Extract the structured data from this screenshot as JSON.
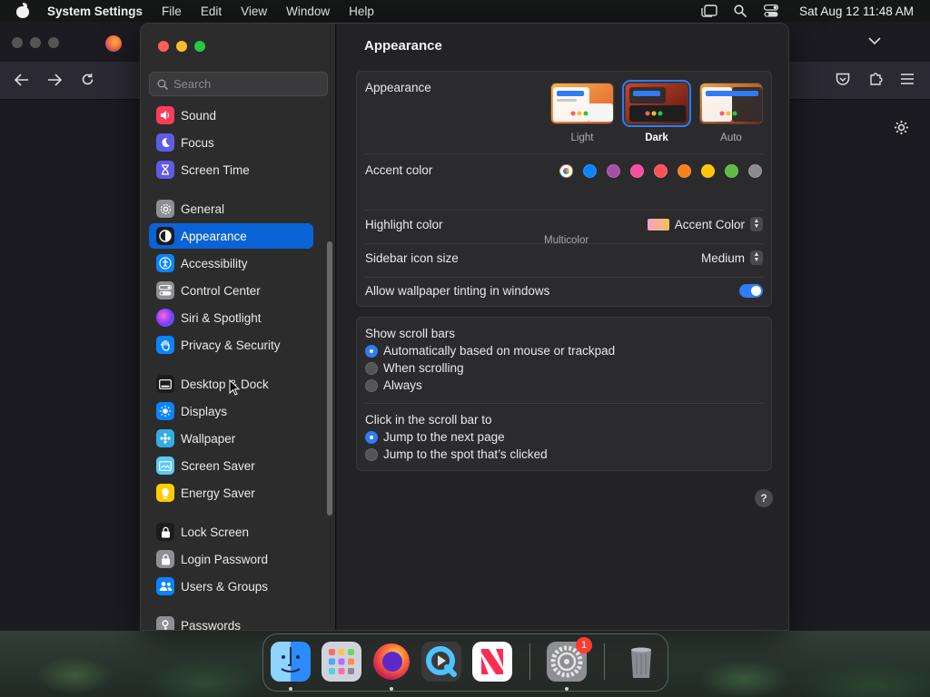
{
  "menubar": {
    "app_name": "System Settings",
    "menus": [
      "File",
      "Edit",
      "View",
      "Window",
      "Help"
    ],
    "clock": "Sat Aug 12  11:48 AM"
  },
  "search": {
    "placeholder": "Search"
  },
  "sidebar": {
    "items": [
      {
        "label": "Sound",
        "icon": "speaker-icon",
        "color": "#ff3b5c"
      },
      {
        "label": "Focus",
        "icon": "moon-icon",
        "color": "#5e5ce6"
      },
      {
        "label": "Screen Time",
        "icon": "hourglass-icon",
        "color": "#5e5ce6"
      },
      {
        "label": "General",
        "icon": "gear-icon",
        "color": "#8e8e93"
      },
      {
        "label": "Appearance",
        "icon": "appearance-icon",
        "color": "#1c1c1e"
      },
      {
        "label": "Accessibility",
        "icon": "accessibility-icon",
        "color": "#0a84ff"
      },
      {
        "label": "Control Center",
        "icon": "control-center-icon",
        "color": "#8e8e93"
      },
      {
        "label": "Siri & Spotlight",
        "icon": "siri-icon",
        "color": "#bf5af2"
      },
      {
        "label": "Privacy & Security",
        "icon": "hand-icon",
        "color": "#0a84ff"
      },
      {
        "label": "Desktop & Dock",
        "icon": "dock-icon",
        "color": "#1c1c1e"
      },
      {
        "label": "Displays",
        "icon": "sun-icon",
        "color": "#0a84ff"
      },
      {
        "label": "Wallpaper",
        "icon": "wallpaper-icon",
        "color": "#32ade6"
      },
      {
        "label": "Screen Saver",
        "icon": "screen-saver-icon",
        "color": "#5ac8fa"
      },
      {
        "label": "Energy Saver",
        "icon": "lightbulb-icon",
        "color": "#ffcc00"
      },
      {
        "label": "Lock Screen",
        "icon": "lock-icon",
        "color": "#1c1c1e"
      },
      {
        "label": "Login Password",
        "icon": "key-lock-icon",
        "color": "#8e8e93"
      },
      {
        "label": "Users & Groups",
        "icon": "users-icon",
        "color": "#0a84ff"
      },
      {
        "label": "Passwords",
        "icon": "key-icon",
        "color": "#8e8e93"
      }
    ]
  },
  "main": {
    "title": "Appearance",
    "appearance": {
      "label": "Appearance",
      "options": [
        "Light",
        "Dark",
        "Auto"
      ],
      "selected": "Dark"
    },
    "accent": {
      "label": "Accent color",
      "caption": "Multicolor",
      "colors": [
        "#ff6b6b",
        "#0a84ff",
        "#a550a7",
        "#f74f9e",
        "#ff5257",
        "#f7821b",
        "#ffc600",
        "#62ba46",
        "#8c8c8c"
      ]
    },
    "highlight": {
      "label": "Highlight color",
      "value": "Accent Color"
    },
    "sidebar_icon_size": {
      "label": "Sidebar icon size",
      "value": "Medium"
    },
    "wallpaper_tinting": {
      "label": "Allow wallpaper tinting in windows",
      "on": true
    },
    "scroll_bars": {
      "label": "Show scroll bars",
      "options": [
        "Automatically based on mouse or trackpad",
        "When scrolling",
        "Always"
      ],
      "selected": 0
    },
    "click_scroll": {
      "label": "Click in the scroll bar to",
      "options": [
        "Jump to the next page",
        "Jump to the spot that’s clicked"
      ],
      "selected": 0
    },
    "help": "?"
  },
  "dock": {
    "apps": [
      "Finder",
      "Launchpad",
      "Firefox",
      "QuickTime Player",
      "News",
      "System Settings",
      "Trash"
    ],
    "badge": "1"
  }
}
